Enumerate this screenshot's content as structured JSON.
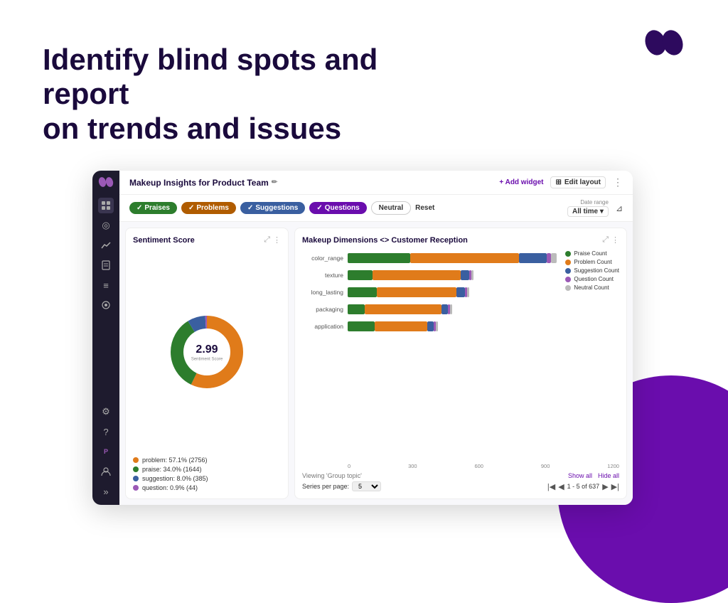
{
  "hero": {
    "title_line1": "Identify blind spots and report",
    "title_line2": "on trends and issues"
  },
  "dashboard": {
    "title": "Makeup Insights for Product Team",
    "add_widget": "+ Add widget",
    "edit_layout": "Edit layout",
    "filter_chips": [
      {
        "id": "praises",
        "label": "Praises",
        "class": "chip-praises"
      },
      {
        "id": "problems",
        "label": "Problems",
        "class": "chip-problems"
      },
      {
        "id": "suggestions",
        "label": "Suggestions",
        "class": "chip-suggestions"
      },
      {
        "id": "questions",
        "label": "Questions",
        "class": "chip-questions"
      },
      {
        "id": "neutral",
        "label": "Neutral",
        "class": "chip-neutral"
      }
    ],
    "reset": "Reset",
    "date_range_label": "Date range",
    "date_range_value": "All time",
    "sentiment_panel": {
      "title": "Sentiment Score",
      "score": "2.99",
      "score_label": "Sentiment Score",
      "donut": {
        "segments": [
          {
            "color": "#e07b1a",
            "pct": 57.1,
            "label": "problem"
          },
          {
            "color": "#2d7d2d",
            "pct": 34.0,
            "label": "praise"
          },
          {
            "color": "#3a5fa0",
            "pct": 8.0,
            "label": "suggestion"
          },
          {
            "color": "#9b59b6",
            "pct": 0.9,
            "label": "question"
          }
        ]
      },
      "legend": [
        {
          "color": "#e07b1a",
          "label": "problem: 57.1% (2756)"
        },
        {
          "color": "#2d7d2d",
          "label": "praise: 34.0% (1644)"
        },
        {
          "color": "#3a5fa0",
          "label": "suggestion: 8.0% (385)"
        },
        {
          "color": "#9b59b6",
          "label": "question: 0.9% (44)"
        }
      ]
    },
    "bar_panel": {
      "title": "Makeup Dimensions <> Customer Reception",
      "legend": [
        {
          "color": "#2d7d2d",
          "label": "Praise Count"
        },
        {
          "color": "#e07b1a",
          "label": "Problem Count"
        },
        {
          "color": "#3a5fa0",
          "label": "Suggestion Count"
        },
        {
          "color": "#9b59b6",
          "label": "Question Count"
        },
        {
          "color": "#bbb",
          "label": "Neutral Count"
        }
      ],
      "rows": [
        {
          "label": "color_range",
          "segments": [
            {
              "color": "#2d7d2d",
              "pct": 30
            },
            {
              "color": "#e07b1a",
              "pct": 52
            },
            {
              "color": "#3a5fa0",
              "pct": 13
            },
            {
              "color": "#9b59b6",
              "pct": 2
            },
            {
              "color": "#bbb",
              "pct": 3
            }
          ]
        },
        {
          "label": "texture",
          "segments": [
            {
              "color": "#2d7d2d",
              "pct": 12
            },
            {
              "color": "#e07b1a",
              "pct": 42
            },
            {
              "color": "#3a5fa0",
              "pct": 4
            },
            {
              "color": "#9b59b6",
              "pct": 1
            },
            {
              "color": "#bbb",
              "pct": 1
            }
          ]
        },
        {
          "label": "long_lasting",
          "segments": [
            {
              "color": "#2d7d2d",
              "pct": 14
            },
            {
              "color": "#e07b1a",
              "pct": 38
            },
            {
              "color": "#3a5fa0",
              "pct": 4
            },
            {
              "color": "#9b59b6",
              "pct": 1
            },
            {
              "color": "#bbb",
              "pct": 1
            }
          ]
        },
        {
          "label": "packaging",
          "segments": [
            {
              "color": "#2d7d2d",
              "pct": 8
            },
            {
              "color": "#e07b1a",
              "pct": 37
            },
            {
              "color": "#3a5fa0",
              "pct": 3
            },
            {
              "color": "#9b59b6",
              "pct": 1
            },
            {
              "color": "#bbb",
              "pct": 1
            }
          ]
        },
        {
          "label": "application",
          "segments": [
            {
              "color": "#2d7d2d",
              "pct": 13
            },
            {
              "color": "#e07b1a",
              "pct": 25
            },
            {
              "color": "#3a5fa0",
              "pct": 3
            },
            {
              "color": "#9b59b6",
              "pct": 1
            },
            {
              "color": "#bbb",
              "pct": 1
            }
          ]
        }
      ],
      "x_axis_labels": [
        "0",
        "300",
        "600",
        "900",
        "1200"
      ],
      "viewing_label": "Viewing 'Group topic'",
      "series_per_page_label": "Series per page:",
      "series_per_page_value": "5",
      "pagination_info": "1 - 5 of 637",
      "show_all": "Show all",
      "hide_all": "Hide all"
    }
  },
  "sidebar": {
    "icons": [
      "📊",
      "🎯",
      "📈",
      "📄",
      "≡",
      "◎"
    ],
    "bottom_icons": [
      "⚙",
      "❓",
      "P",
      "👤",
      "⬛"
    ]
  }
}
